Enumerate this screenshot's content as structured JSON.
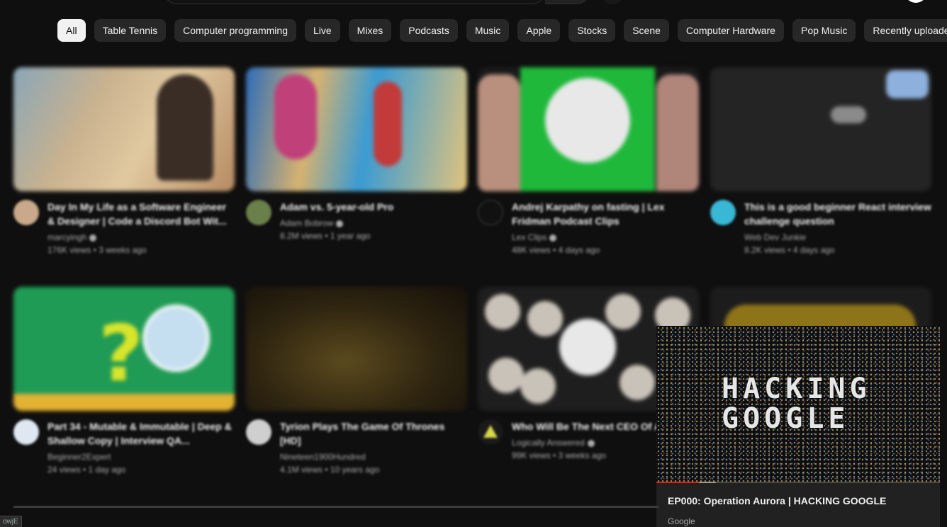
{
  "chips": [
    {
      "label": "All",
      "active": true
    },
    {
      "label": "Table Tennis"
    },
    {
      "label": "Computer programming"
    },
    {
      "label": "Live"
    },
    {
      "label": "Mixes"
    },
    {
      "label": "Podcasts"
    },
    {
      "label": "Music"
    },
    {
      "label": "Apple"
    },
    {
      "label": "Stocks"
    },
    {
      "label": "Scene"
    },
    {
      "label": "Computer Hardware"
    },
    {
      "label": "Pop Music"
    },
    {
      "label": "Recently uploaded"
    }
  ],
  "videos": [
    {
      "title": "Day In My Life as a Software Engineer & Designer | Code a Discord Bot Wit...",
      "channel": "marcyingh",
      "stats": "176K views • 3 weeks ago"
    },
    {
      "title": "Adam vs. 5-year-old Pro",
      "channel": "Adam Bobrow",
      "stats": "8.2M views • 1 year ago"
    },
    {
      "title": "Andrej Karpathy on fasting | Lex Fridman Podcast Clips",
      "channel": "Lex Clips",
      "stats": "48K views • 4 days ago"
    },
    {
      "title": "This is a good beginner React interview challenge question",
      "channel": "Web Dev Junkie",
      "stats": "8.2K views • 4 days ago"
    },
    {
      "title": "Part 34 - Mutable & Immutable | Deep & Shallow Copy | Interview QA...",
      "channel": "Beginner2Expert",
      "stats": "24 views • 1 day ago"
    },
    {
      "title": "Tyrion Plays The Game Of Thrones [HD]",
      "channel": "Nineteen1900Hundred",
      "stats": "4.1M views • 10 years ago"
    },
    {
      "title": "Who Will Be The Next CEO Of Apple?",
      "channel": "Logically Answered",
      "stats": "99K views • 3 weeks ago"
    }
  ],
  "miniplayer": {
    "art_line1": "HACKING",
    "art_line2": "GOOGLE",
    "title": "EP000: Operation Aurora | HACKING GOOGLE",
    "channel": "Google",
    "progress_played": 0.15,
    "progress_buffered_end": 0.21,
    "progress_color": "#e62117"
  },
  "status_bar": {
    "text": "owjE"
  }
}
